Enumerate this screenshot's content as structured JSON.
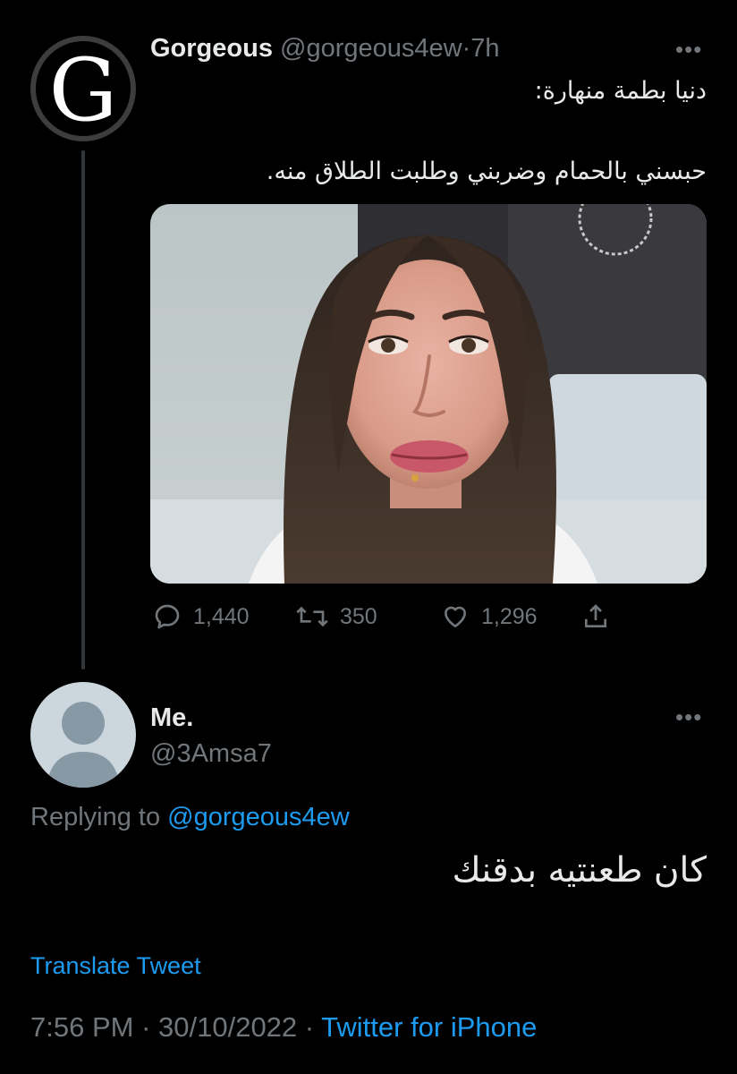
{
  "parent_tweet": {
    "avatar_letter": "G",
    "author_name": "Gorgeous",
    "author_handle": "@gorgeous4ew",
    "separator": "·",
    "time": "7h",
    "text_line1": "دنيا بطمة منهارة:",
    "text_line2": "حبسني بالحمام وضربني وطلبت الطلاق منه.",
    "media": "photo-crying-woman",
    "stats": {
      "replies": "1,440",
      "retweets": "350",
      "likes": "1,296"
    },
    "icons": {
      "more": "more-horizontal-icon",
      "reply": "reply-bubble-icon",
      "retweet": "retweet-icon",
      "like": "heart-icon",
      "share": "share-icon"
    }
  },
  "reply_tweet": {
    "author_name": "Me.",
    "author_handle": "@3Amsa7",
    "replying_prefix": "Replying to ",
    "replying_mention": "@gorgeous4ew",
    "text": "كان طعنتيه بدقنك",
    "translate_label": "Translate Tweet",
    "time": "7:56 PM",
    "date": "30/10/2022",
    "separator": " · ",
    "source": "Twitter for iPhone"
  },
  "colors": {
    "background": "#000000",
    "text": "#e7e9ea",
    "muted": "#71767b",
    "accent": "#1d9bf0"
  }
}
